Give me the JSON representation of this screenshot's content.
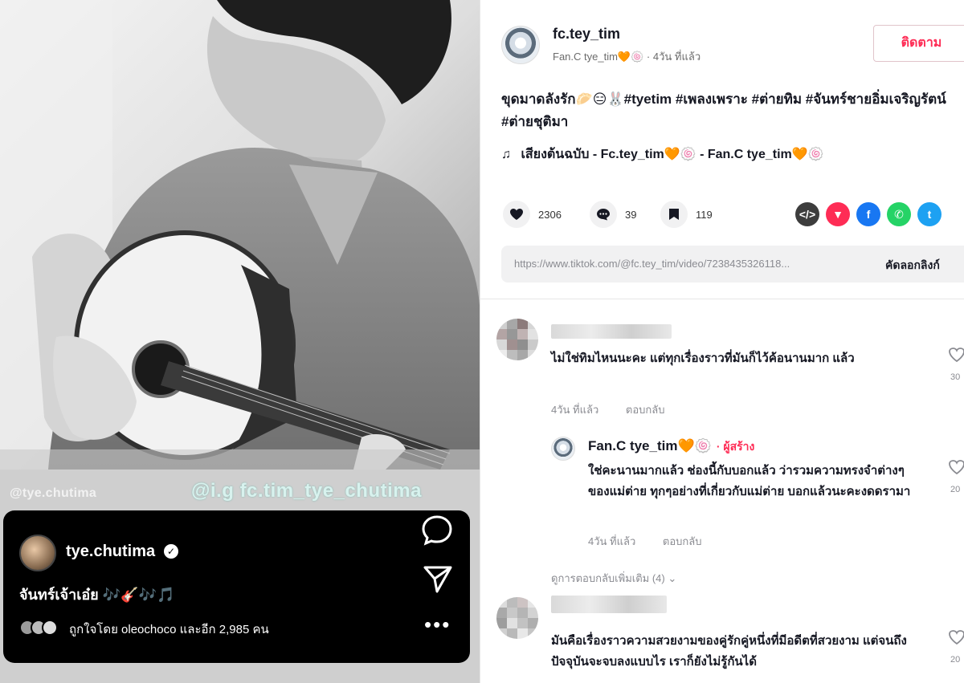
{
  "video": {
    "watermark_left": "@tye.chutima",
    "watermark_right": "@i.g fc.tim_tye_chutima",
    "ig_post": {
      "username": "tye.chutima",
      "caption": "จันทร์เจ้าเอ๋ย 🎶🎸🎶🎵",
      "liked_by": "ถูกใจโดย oleochoco และอีก 2,985 คน"
    },
    "icons": [
      "comment-icon",
      "share-icon",
      "more-icon"
    ]
  },
  "author": {
    "handle": "fc.tey_tim",
    "display_name": "Fan.C tye_tim🧡🍥",
    "time": "4วัน ที่แล้ว",
    "follow_label": "ติดตาม"
  },
  "description": "ขุดมาดลังรัก🥟😑🐰#tyetim #เพลงเพราะ #ต่ายทิม #จันทร์ชายอิ่มเจริญรัตน์ #ต่ายชุติมา",
  "music": "เสียงต้นฉบับ - Fc.tey_tim🧡🍥 - Fan.C tye_tim🧡🍥",
  "stats": {
    "likes": "2306",
    "comments": "39",
    "saves": "119"
  },
  "share_icons": [
    {
      "name": "embed-icon",
      "glyph": "</>",
      "color": "#3d3d3d"
    },
    {
      "name": "tiktok-send-icon",
      "glyph": "▼",
      "color": "#fe2c55"
    },
    {
      "name": "facebook-icon",
      "glyph": "f",
      "color": "#1877f2"
    },
    {
      "name": "whatsapp-icon",
      "glyph": "✆",
      "color": "#25d366"
    },
    {
      "name": "twitter-icon",
      "glyph": "t",
      "color": "#1da1f2"
    }
  ],
  "link": {
    "url": "https://www.tiktok.com/@fc.tey_tim/video/7238435326118...",
    "copy_label": "คัดลอกลิงก์"
  },
  "comments": [
    {
      "text": "ไม่ใช่ทิมไหนนะคะ แต่ทุกเรื่องราวที่มันก็ไว้ค้อนานมาก แล้ว",
      "time": "4วัน ที่แล้ว",
      "reply_label": "ตอบกลับ",
      "likes": "30",
      "reply": {
        "name": "Fan.C tye_tim🧡🍥",
        "badge": "· ผู้สร้าง",
        "text": "ใช่คะนานมากแล้ว ช่องนี้กับบอกแล้ว ว่ารวมความทรงจำต่างๆของแม่ต่าย ทุกๆอย่างที่เกี่ยวกับแม่ต่าย บอกแล้วนะคะงดดรามา",
        "time": "4วัน ที่แล้ว",
        "reply_label": "ตอบกลับ",
        "likes": "20"
      },
      "more_replies": "ดูการตอบกลับเพิ่มเติม (4)"
    },
    {
      "text": "มันคือเรื่องราวความสวยงามของคู่รักคู่หนึ่งที่มีอดีตที่สวยงาม แต่จนถึงปัจจุบันจะจบลงแบบไร เราก็ยังไม่รู้กันได้",
      "likes": "20"
    }
  ]
}
